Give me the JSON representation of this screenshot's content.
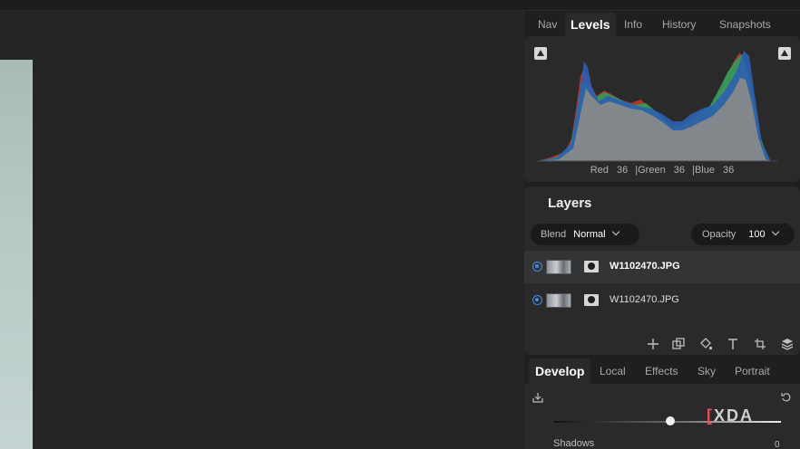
{
  "panel_tabs": [
    {
      "label": "Nav",
      "active": false
    },
    {
      "label": "Levels",
      "active": true
    },
    {
      "label": "Info",
      "active": false
    },
    {
      "label": "History",
      "active": false
    },
    {
      "label": "Snapshots",
      "active": false
    }
  ],
  "histogram": {
    "red_label": "Red",
    "red_value": "36",
    "green_label": "Green",
    "green_value": "36",
    "blue_label": "Blue",
    "blue_value": "36",
    "separator": "|"
  },
  "layers": {
    "title": "Layers",
    "blend_label": "Blend",
    "blend_value": "Normal",
    "opacity_label": "Opacity",
    "opacity_value": "100",
    "items": [
      {
        "name": "W1102470.JPG",
        "selected": true
      },
      {
        "name": "W1102470.JPG",
        "selected": false
      }
    ]
  },
  "layer_tools": [
    "add-layer-icon",
    "duplicate-layer-icon",
    "fill-icon",
    "text-icon",
    "crop-layer-icon",
    "layers-stack-icon"
  ],
  "develop_tabs": [
    {
      "label": "Develop",
      "active": true
    },
    {
      "label": "Local",
      "active": false
    },
    {
      "label": "Effects",
      "active": false
    },
    {
      "label": "Sky",
      "active": false
    },
    {
      "label": "Portrait",
      "active": false
    }
  ],
  "develop": {
    "shadows_label": "Shadows",
    "shadows_value": "0",
    "tone_slider_level": 0.51
  },
  "watermark": {
    "bracket": "[",
    "text": "XDA"
  },
  "colors": {
    "accent": "#3f8fe8",
    "panel_bg": "#1f1f1f",
    "section_bg": "#2a2a2a",
    "canvas_bg": "#252525"
  }
}
